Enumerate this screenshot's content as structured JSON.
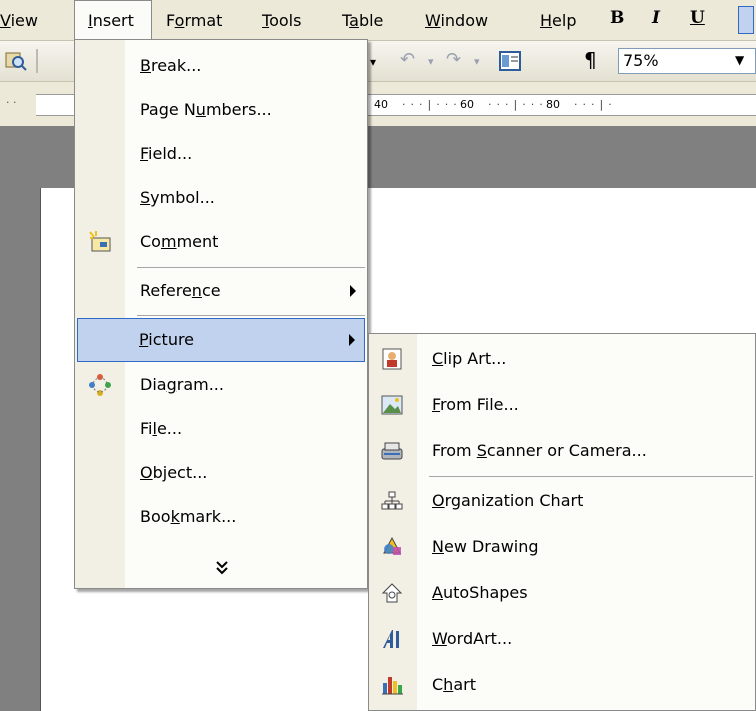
{
  "menubar": {
    "items": [
      {
        "pre": "",
        "ul": "V",
        "post": "iew"
      },
      {
        "pre": "",
        "ul": "I",
        "post": "nsert"
      },
      {
        "pre": "F",
        "ul": "o",
        "post": "rmat"
      },
      {
        "pre": "",
        "ul": "T",
        "post": "ools"
      },
      {
        "pre": "T",
        "ul": "a",
        "post": "ble"
      },
      {
        "pre": "",
        "ul": "W",
        "post": "indow"
      },
      {
        "pre": "",
        "ul": "H",
        "post": "elp"
      }
    ],
    "format_buttons": {
      "bold": "B",
      "italic": "I",
      "underline": "U"
    }
  },
  "toolbar": {
    "zoom": "75%",
    "paragraph_mark": "¶"
  },
  "ruler": {
    "ticks": [
      "40",
      "60",
      "80"
    ]
  },
  "insert_menu": {
    "items": [
      {
        "pre": "",
        "ul": "B",
        "post": "reak...",
        "icon": ""
      },
      {
        "pre": "Page N",
        "ul": "u",
        "post": "mbers...",
        "icon": ""
      },
      {
        "pre": "",
        "ul": "F",
        "post": "ield...",
        "icon": ""
      },
      {
        "pre": "",
        "ul": "S",
        "post": "ymbol...",
        "icon": ""
      },
      {
        "pre": "Co",
        "ul": "m",
        "post": "ment",
        "icon": "comment-icon"
      },
      {
        "pre": "Refere",
        "ul": "n",
        "post": "ce",
        "icon": "",
        "submenu": true
      },
      {
        "pre": "",
        "ul": "P",
        "post": "icture",
        "icon": "",
        "submenu": true,
        "highlighted": true
      },
      {
        "pre": "Dia",
        "ul": "g",
        "post": "ram...",
        "icon": "diagram-icon"
      },
      {
        "pre": "Fi",
        "ul": "l",
        "post": "e...",
        "icon": ""
      },
      {
        "pre": "",
        "ul": "O",
        "post": "bject...",
        "icon": ""
      },
      {
        "pre": "Boo",
        "ul": "k",
        "post": "mark...",
        "icon": ""
      }
    ],
    "expand_glyph": "≈"
  },
  "picture_submenu": {
    "items": [
      {
        "pre": "",
        "ul": "C",
        "post": "lip Art...",
        "icon": "clip-art-icon"
      },
      {
        "pre": "",
        "ul": "F",
        "post": "rom File...",
        "icon": "from-file-icon"
      },
      {
        "pre": "From ",
        "ul": "S",
        "post": "canner or Camera...",
        "icon": "scanner-icon"
      },
      {
        "pre": "",
        "ul": "O",
        "post": "rganization Chart",
        "icon": "org-chart-icon"
      },
      {
        "pre": "",
        "ul": "N",
        "post": "ew Drawing",
        "icon": "new-drawing-icon"
      },
      {
        "pre": "",
        "ul": "A",
        "post": "utoShapes",
        "icon": "autoshapes-icon"
      },
      {
        "pre": "",
        "ul": "W",
        "post": "ordArt...",
        "icon": "wordart-icon"
      },
      {
        "pre": "C",
        "ul": "h",
        "post": "art",
        "icon": "chart-icon"
      }
    ]
  },
  "colors": {
    "menu_bg": "#fcfcf9",
    "menu_strip": "#f2f0e4",
    "highlight_bg": "#c1d2ee",
    "highlight_border": "#316ac5",
    "chrome": "#ece9d8"
  }
}
